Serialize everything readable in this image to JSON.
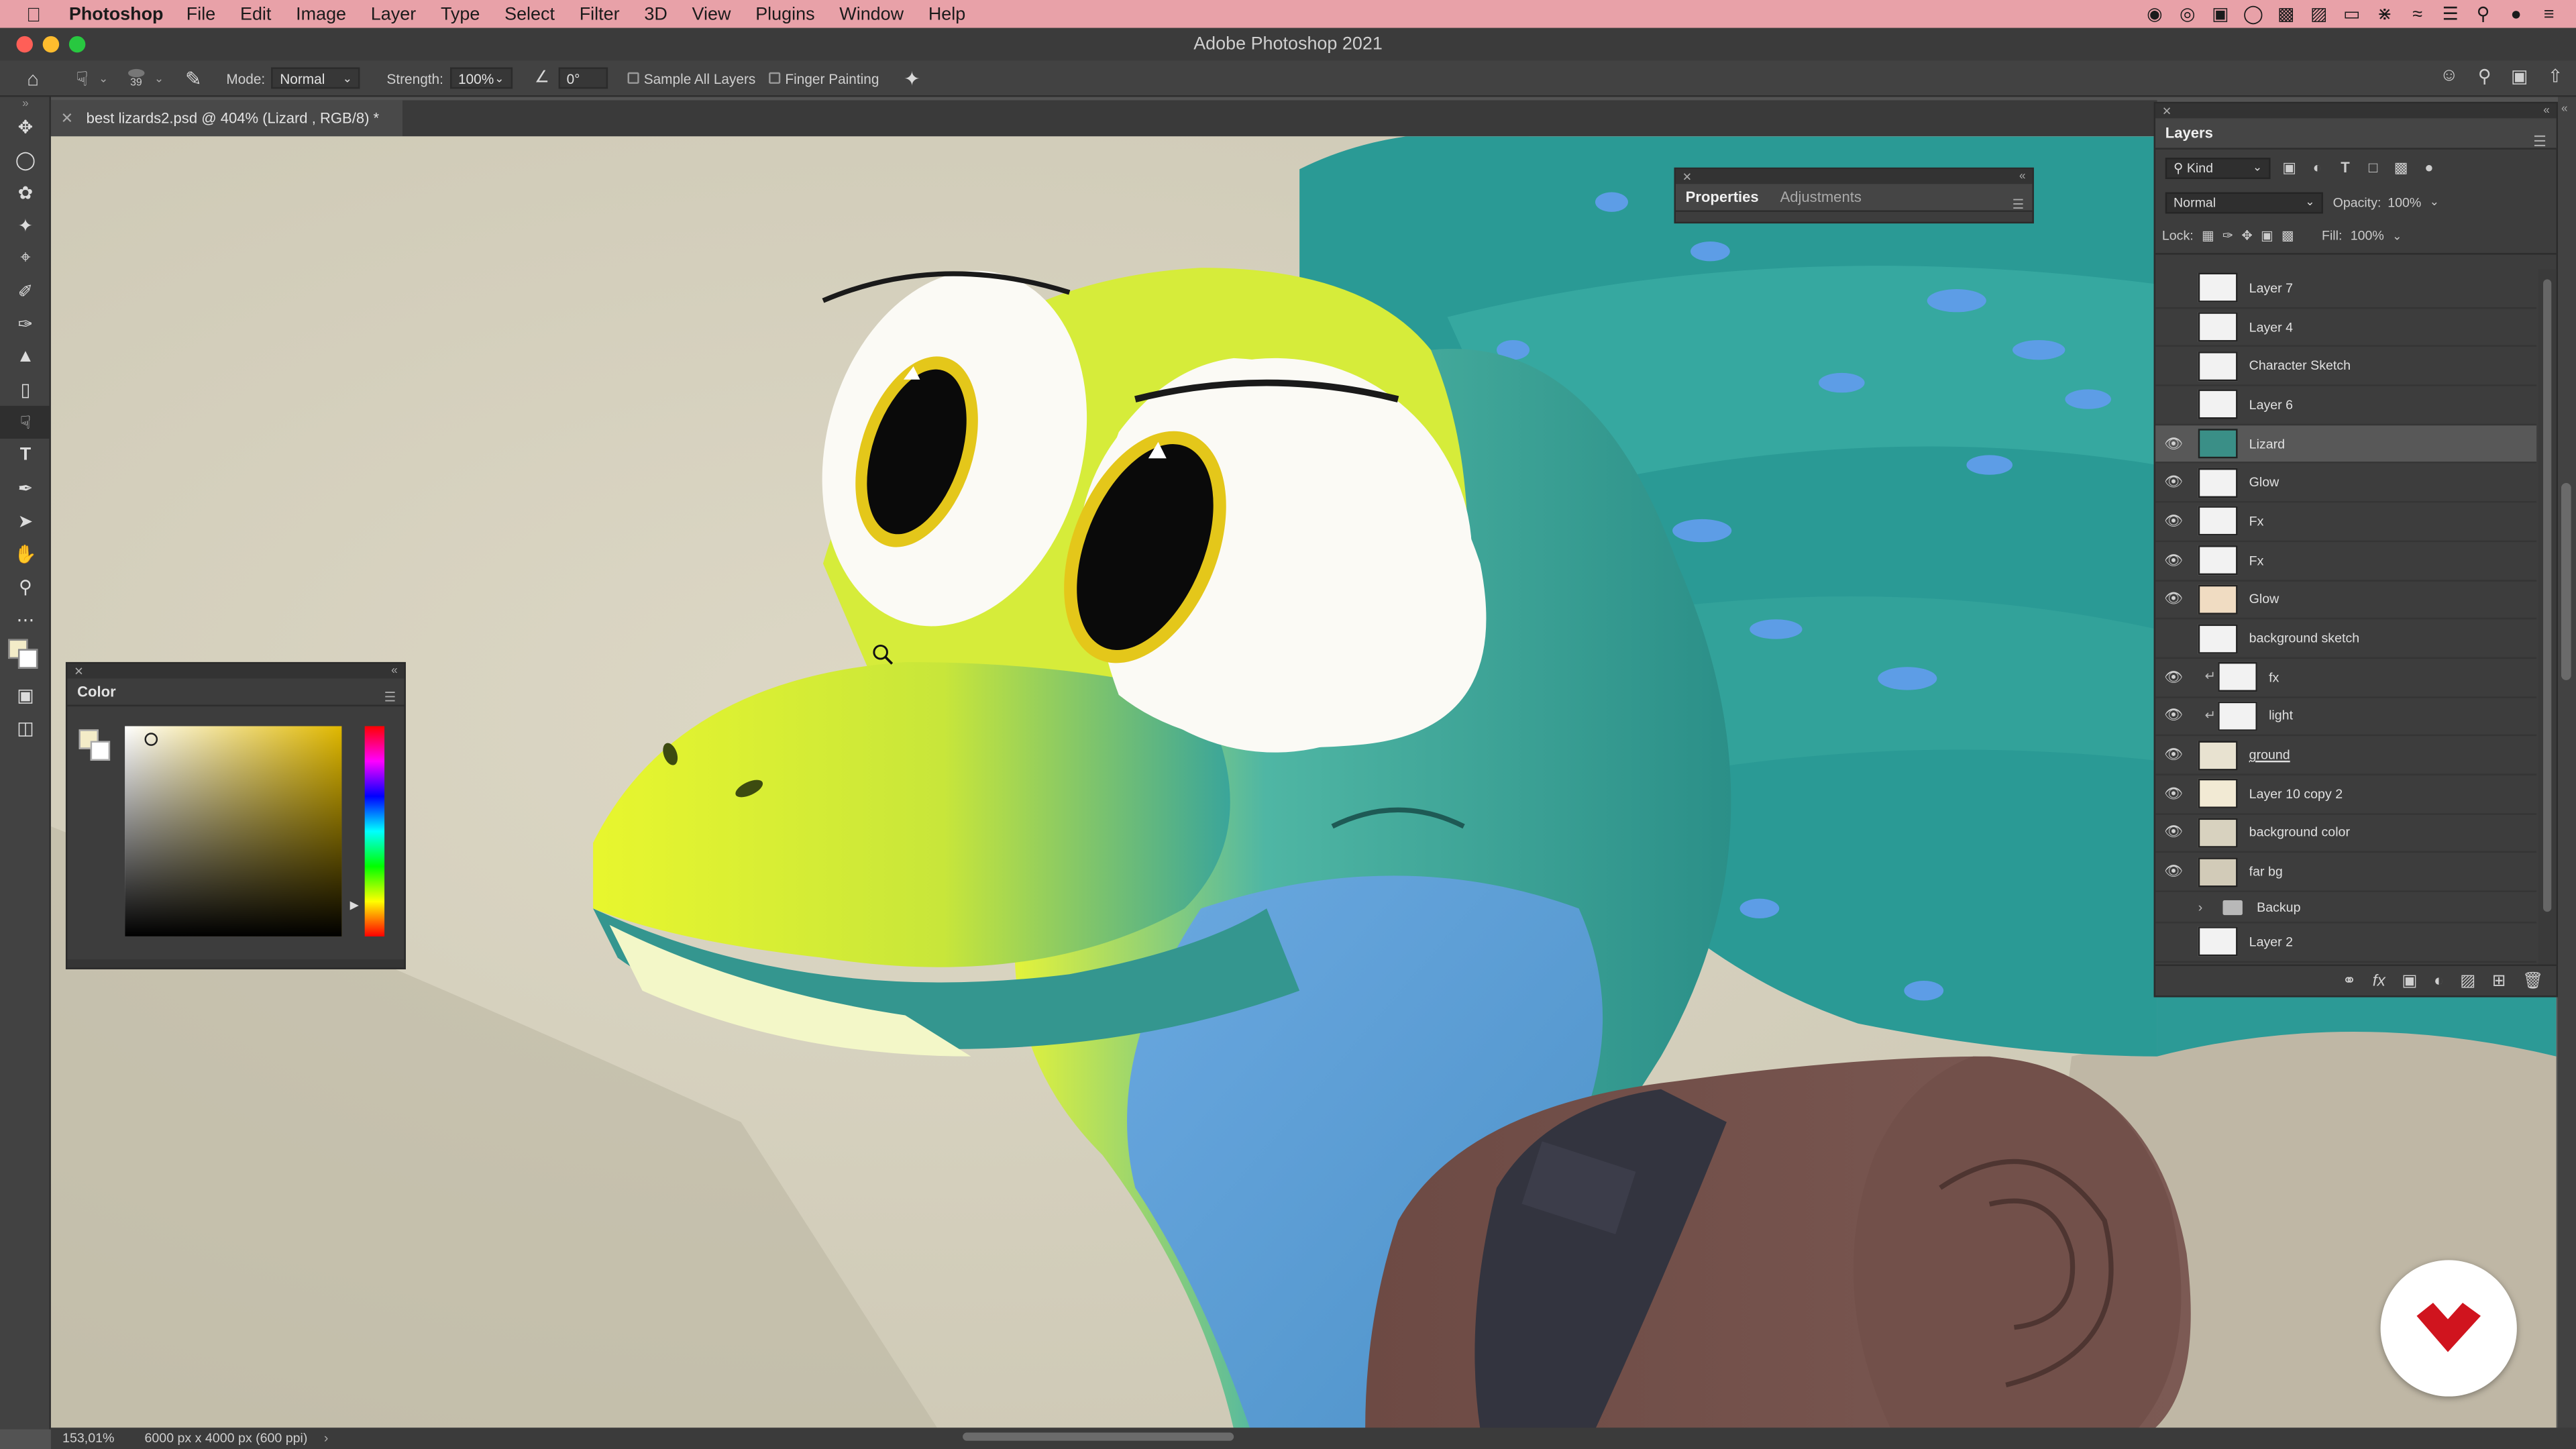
{
  "menubar": {
    "app_name": "Photoshop",
    "items": [
      "File",
      "Edit",
      "Image",
      "Layer",
      "Type",
      "Select",
      "Filter",
      "3D",
      "View",
      "Plugins",
      "Window",
      "Help"
    ]
  },
  "window": {
    "title": "Adobe Photoshop 2021"
  },
  "options": {
    "brush_size": "39",
    "mode_label": "Mode:",
    "mode_value": "Normal",
    "strength_label": "Strength:",
    "strength_value": "100%",
    "angle_value": "0°",
    "sample_all_label": "Sample All Layers",
    "finger_label": "Finger Painting"
  },
  "document": {
    "tab_title": "best lizards2.psd @ 404% (Lizard , RGB/8) *"
  },
  "status": {
    "zoom": "153,01%",
    "info": "6000 px x 4000 px (600 ppi)"
  },
  "properties_panel": {
    "tab1": "Properties",
    "tab2": "Adjustments"
  },
  "color_panel": {
    "title": "Color",
    "foreground": "#f3ecc8",
    "background": "#ffffff"
  },
  "layers_panel": {
    "title": "Layers",
    "filter_kind": "Kind",
    "blend_mode": "Normal",
    "opacity_label": "Opacity:",
    "opacity_value": "100%",
    "lock_label": "Lock:",
    "fill_label": "Fill:",
    "fill_value": "100%",
    "layers": [
      {
        "name": "Layer 7",
        "visible": false
      },
      {
        "name": "Layer 4",
        "visible": false
      },
      {
        "name": "Character Sketch",
        "visible": false
      },
      {
        "name": "Layer 6",
        "visible": false
      },
      {
        "name": "Lizard",
        "visible": true,
        "selected": true
      },
      {
        "name": "Glow",
        "visible": true
      },
      {
        "name": "Fx",
        "visible": true
      },
      {
        "name": "Fx",
        "visible": true
      },
      {
        "name": "Glow",
        "visible": true
      },
      {
        "name": "background sketch",
        "visible": false
      },
      {
        "name": "fx",
        "visible": true,
        "clipped": true
      },
      {
        "name": "light",
        "visible": true,
        "clipped": true
      },
      {
        "name": "ground",
        "visible": true
      },
      {
        "name": "Layer 10 copy 2",
        "visible": true
      },
      {
        "name": "background color",
        "visible": true
      },
      {
        "name": "far bg",
        "visible": true
      },
      {
        "name": "Backup",
        "visible": false,
        "group": true
      },
      {
        "name": "Layer 2",
        "visible": false
      }
    ]
  },
  "colors": {
    "accent_logo": "#d0141e",
    "menubar": "#e8a1a8"
  }
}
